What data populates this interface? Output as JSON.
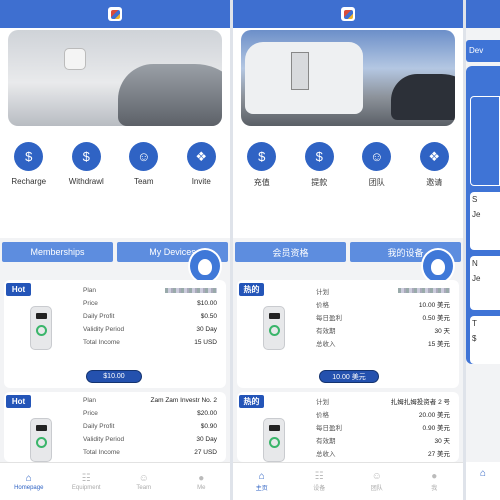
{
  "colors": {
    "primary": "#3e6fd0",
    "tab": "#5d8ddf",
    "hot": "#2455b8"
  },
  "screens": [
    {
      "icons": [
        {
          "label": "Recharge",
          "icon": "wallet-icon"
        },
        {
          "label": "Withdrawl",
          "icon": "money-bag-icon"
        },
        {
          "label": "Team",
          "icon": "team-icon"
        },
        {
          "label": "Invite",
          "icon": "gift-icon"
        }
      ],
      "tabs": [
        "Memberships",
        "My Devices"
      ],
      "cards": [
        {
          "badge": "Hot",
          "rows": [
            {
              "k": "Plan",
              "v": ""
            },
            {
              "k": "Price",
              "v": "$10.00"
            },
            {
              "k": "Daily Profit",
              "v": "$0.50"
            },
            {
              "k": "Validity Period",
              "v": "30 Day"
            },
            {
              "k": "Total Income",
              "v": "15 USD"
            }
          ],
          "button": "$10.00"
        },
        {
          "badge": "Hot",
          "rows": [
            {
              "k": "Plan",
              "v": "Zam Zam Investr No. 2"
            },
            {
              "k": "Price",
              "v": "$20.00"
            },
            {
              "k": "Daily Profit",
              "v": "$0.90"
            },
            {
              "k": "Validity Period",
              "v": "30 Day"
            },
            {
              "k": "Total Income",
              "v": "27 USD"
            }
          ]
        }
      ],
      "nav": [
        "Homepage",
        "Equipment",
        "Team",
        "Me"
      ]
    },
    {
      "icons": [
        {
          "label": "充值",
          "icon": "wallet-icon"
        },
        {
          "label": "提款",
          "icon": "money-bag-icon"
        },
        {
          "label": "团队",
          "icon": "team-icon"
        },
        {
          "label": "邀请",
          "icon": "gift-icon"
        }
      ],
      "tabs": [
        "会员资格",
        "我的设备"
      ],
      "cards": [
        {
          "badge": "热的",
          "rows": [
            {
              "k": "计划",
              "v": ""
            },
            {
              "k": "价格",
              "v": "10.00 美元"
            },
            {
              "k": "每日盈利",
              "v": "0.50 美元"
            },
            {
              "k": "有效期",
              "v": "30 天"
            },
            {
              "k": "总收入",
              "v": "15 美元"
            }
          ],
          "button": "10.00 美元"
        },
        {
          "badge": "热的",
          "rows": [
            {
              "k": "计划",
              "v": "扎姆扎姆投资者 2 号"
            },
            {
              "k": "价格",
              "v": "20.00 美元"
            },
            {
              "k": "每日盈利",
              "v": "0.90 美元"
            },
            {
              "k": "有效期",
              "v": "30 天"
            },
            {
              "k": "总收入",
              "v": "27 美元"
            }
          ]
        }
      ],
      "nav": [
        "主页",
        "设备",
        "团队",
        "我"
      ]
    }
  ],
  "partial": {
    "top": "Dev",
    "letters": [
      "S",
      "Je",
      "N",
      "Je",
      "T",
      "$"
    ]
  }
}
